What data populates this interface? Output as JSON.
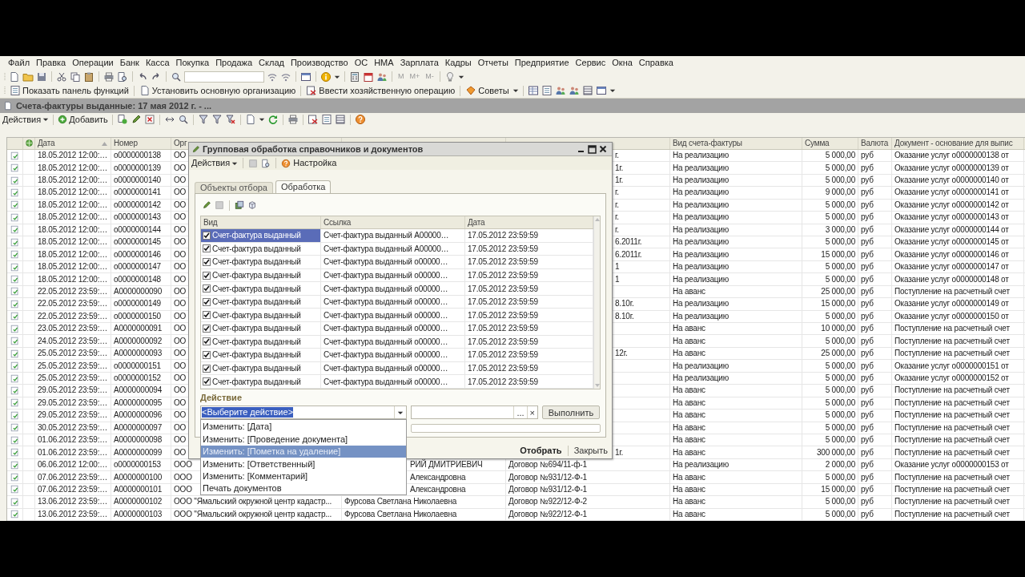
{
  "menu_bar": [
    "Файл",
    "Правка",
    "Операции",
    "Банк",
    "Касса",
    "Покупка",
    "Продажа",
    "Склад",
    "Производство",
    "ОС",
    "НМА",
    "Зарплата",
    "Кадры",
    "Отчеты",
    "Предприятие",
    "Сервис",
    "Окна",
    "Справка"
  ],
  "toolbar": {
    "memory_buttons": [
      "M",
      "M+",
      "M-"
    ]
  },
  "function_toolbar": [
    "Показать панель функций",
    "Установить основную организацию",
    "Ввести хозяйственную операцию",
    "Советы"
  ],
  "document_window": {
    "title": "Счета-фактуры выданные: 17 мая 2012 г. - ...",
    "actions_menu": "Действия",
    "add_button": "Добавить"
  },
  "table": {
    "columns": [
      {
        "label": "Дата",
        "sorted": true
      },
      {
        "label": "Номер",
        "sorted": false
      },
      {
        "label": "Орг"
      },
      {
        "label": "Вид счета-фактуры",
        "sorted": false
      },
      {
        "label": "Сумма",
        "sorted": false
      },
      {
        "label": "Валюта",
        "sorted": false
      },
      {
        "label": "Документ - основание для выпис",
        "sorted": false
      }
    ],
    "rows": [
      {
        "date": "18.05.2012 12:00:…",
        "number": "о0000000138",
        "org": "ОО",
        "column_6": "г.",
        "type": "На реализацию",
        "sum": "5 000,00",
        "currency": "руб",
        "basis": "Оказание услуг о0000000138 от"
      },
      {
        "date": "18.05.2012 12:00:…",
        "number": "о0000000139",
        "org": "ОО",
        "column_6": "1г.",
        "type": "На реализацию",
        "sum": "5 000,00",
        "currency": "руб",
        "basis": "Оказание услуг о0000000139 от"
      },
      {
        "date": "18.05.2012 12:00:…",
        "number": "о0000000140",
        "org": "ОО",
        "column_6": "1г.",
        "type": "На реализацию",
        "sum": "5 000,00",
        "currency": "руб",
        "basis": "Оказание услуг о0000000140 от"
      },
      {
        "date": "18.05.2012 12:00:…",
        "number": "о0000000141",
        "org": "ОО",
        "column_6": "г.",
        "type": "На реализацию",
        "sum": "9 000,00",
        "currency": "руб",
        "basis": "Оказание услуг о0000000141 от"
      },
      {
        "date": "18.05.2012 12:00:…",
        "number": "о0000000142",
        "org": "ОО",
        "column_6": "г.",
        "type": "На реализацию",
        "sum": "5 000,00",
        "currency": "руб",
        "basis": "Оказание услуг о0000000142 от"
      },
      {
        "date": "18.05.2012 12:00:…",
        "number": "о0000000143",
        "org": "ОО",
        "column_6": "г.",
        "type": "На реализацию",
        "sum": "5 000,00",
        "currency": "руб",
        "basis": "Оказание услуг о0000000143 от"
      },
      {
        "date": "18.05.2012 12:00:…",
        "number": "о0000000144",
        "org": "ОО",
        "column_6": "г.",
        "type": "На реализацию",
        "sum": "3 000,00",
        "currency": "руб",
        "basis": "Оказание услуг о0000000144 от"
      },
      {
        "date": "18.05.2012 12:00:…",
        "number": "о0000000145",
        "org": "ОО",
        "column_6": "6.2011г.",
        "type": "На реализацию",
        "sum": "5 000,00",
        "currency": "руб",
        "basis": "Оказание услуг о0000000145 от"
      },
      {
        "date": "18.05.2012 12:00:…",
        "number": "о0000000146",
        "org": "ОО",
        "column_6": "6.2011г.",
        "type": "На реализацию",
        "sum": "15 000,00",
        "currency": "руб",
        "basis": "Оказание услуг о0000000146 от"
      },
      {
        "date": "18.05.2012 12:00:…",
        "number": "о0000000147",
        "org": "ОО",
        "column_6": "1",
        "type": "На реализацию",
        "sum": "5 000,00",
        "currency": "руб",
        "basis": "Оказание услуг о0000000147 от"
      },
      {
        "date": "18.05.2012 12:00:…",
        "number": "о0000000148",
        "org": "ОО",
        "column_6": "1",
        "type": "На реализацию",
        "sum": "5 000,00",
        "currency": "руб",
        "basis": "Оказание услуг о0000000148 от"
      },
      {
        "date": "22.05.2012 23:59:…",
        "number": "А0000000090",
        "org": "ОО",
        "type": "На аванс",
        "sum": "25 000,00",
        "currency": "руб",
        "basis": "Поступление на расчетный счет"
      },
      {
        "date": "22.05.2012 23:59:…",
        "number": "о0000000149",
        "org": "ОО",
        "column_6": "8.10г.",
        "type": "На реализацию",
        "sum": "15 000,00",
        "currency": "руб",
        "basis": "Оказание услуг о0000000149 от"
      },
      {
        "date": "22.05.2012 23:59:…",
        "number": "о0000000150",
        "org": "ОО",
        "column_6": "8.10г.",
        "type": "На реализацию",
        "sum": "5 000,00",
        "currency": "руб",
        "basis": "Оказание услуг о0000000150 от"
      },
      {
        "date": "23.05.2012 23:59:…",
        "number": "А0000000091",
        "org": "ОО",
        "type": "На аванс",
        "sum": "10 000,00",
        "currency": "руб",
        "basis": "Поступление на расчетный счет"
      },
      {
        "date": "24.05.2012 23:59:…",
        "number": "А0000000092",
        "org": "ОО",
        "type": "На аванс",
        "sum": "5 000,00",
        "currency": "руб",
        "basis": "Поступление на расчетный счет"
      },
      {
        "date": "25.05.2012 23:59:…",
        "number": "А0000000093",
        "org": "ОО",
        "column_6": "12г.",
        "type": "На аванс",
        "sum": "25 000,00",
        "currency": "руб",
        "basis": "Поступление на расчетный счет"
      },
      {
        "date": "25.05.2012 23:59:…",
        "number": "о0000000151",
        "org": "ОО",
        "type": "На реализацию",
        "sum": "5 000,00",
        "currency": "руб",
        "basis": "Оказание услуг о0000000151 от"
      },
      {
        "date": "25.05.2012 23:59:…",
        "number": "о0000000152",
        "org": "ОО",
        "type": "На реализацию",
        "sum": "5 000,00",
        "currency": "руб",
        "basis": "Оказание услуг о0000000152 от"
      },
      {
        "date": "29.05.2012 23:59:…",
        "number": "А0000000094",
        "org": "ОО",
        "type": "На аванс",
        "sum": "5 000,00",
        "currency": "руб",
        "basis": "Поступление на расчетный счет"
      },
      {
        "date": "29.05.2012 23:59:…",
        "number": "А0000000095",
        "org": "ОО",
        "type": "На аванс",
        "sum": "5 000,00",
        "currency": "руб",
        "basis": "Поступление на расчетный счет"
      },
      {
        "date": "29.05.2012 23:59:…",
        "number": "А0000000096",
        "org": "ОО",
        "type": "На аванс",
        "sum": "5 000,00",
        "currency": "руб",
        "basis": "Поступление на расчетный счет"
      },
      {
        "date": "30.05.2012 23:59:…",
        "number": "А0000000097",
        "org": "ОО",
        "type": "На аванс",
        "sum": "5 000,00",
        "currency": "руб",
        "basis": "Поступление на расчетный счет"
      },
      {
        "date": "01.06.2012 23:59:…",
        "number": "А0000000098",
        "org": "ОО",
        "type": "На аванс",
        "sum": "5 000,00",
        "currency": "руб",
        "basis": "Поступление на расчетный счет"
      },
      {
        "date": "01.06.2012 23:59:…",
        "number": "А0000000099",
        "org": "ОО",
        "column_6": "1г.",
        "type": "На аванс",
        "sum": "300 000,00",
        "currency": "руб",
        "basis": "Поступление на расчетный счет"
      },
      {
        "date": "06.06.2012 12:00:…",
        "number": "о0000000153",
        "org": "ООО",
        "column_5": "РИЙ ДМИТРИЕВИЧ",
        "column_6": "Договор №694/11-ф-1",
        "type": "На реализацию",
        "sum": "2 000,00",
        "currency": "руб",
        "basis": "Оказание услуг о0000000153 от"
      },
      {
        "date": "07.06.2012 23:59:…",
        "number": "А0000000100",
        "org": "ООО",
        "column_5": "Александровна",
        "column_6": "Договор №931/12-Ф-1",
        "type": "На аванс",
        "sum": "5 000,00",
        "currency": "руб",
        "basis": "Поступление на расчетный счет"
      },
      {
        "date": "07.06.2012 23:59:…",
        "number": "А0000000101",
        "org": "ООО",
        "column_5": "Александровна",
        "column_6": "Договор №931/12-Ф-1",
        "type": "На аванс",
        "sum": "15 000,00",
        "currency": "руб",
        "basis": "Поступление на расчетный счет"
      },
      {
        "date": "13.06.2012 23:59:…",
        "number": "А0000000102",
        "org": "ООО \"Ямальский окружной центр кадастр...",
        "column_5": "Фурсова Светлана Николаевна",
        "column_6": "Договор №922/12-Ф-2",
        "type": "На аванс",
        "sum": "5 000,00",
        "currency": "руб",
        "basis": "Поступление на расчетный счет"
      },
      {
        "date": "13.06.2012 23:59:…",
        "number": "А0000000103",
        "org": "ООО \"Ямальский окружной центр кадастр...",
        "column_5": "Фурсова Светлана Николаевна",
        "column_6": "Договор №922/12-Ф-1",
        "type": "На аванс",
        "sum": "5 000,00",
        "currency": "руб",
        "basis": "Поступление на расчетный счет"
      }
    ]
  },
  "dialog": {
    "title": "Групповая обработка справочников и документов",
    "actions_menu": "Действия",
    "settings_button": "Настройка",
    "tabs": [
      {
        "label": "Объекты отбора",
        "selected": false
      },
      {
        "label": "Обработка",
        "selected": true
      }
    ],
    "table": {
      "columns": [
        "Вид",
        "Ссылка",
        "Дата"
      ],
      "rows": [
        {
          "checked": true,
          "selected": true,
          "kind_name": "Счет-фактура выданный",
          "link": "Счет-фактура выданный А00000…",
          "date": "17.05.2012 23:59:59"
        },
        {
          "checked": true,
          "selected": false,
          "kind_name": "Счет-фактура выданный",
          "link": "Счет-фактура выданный А00000…",
          "date": "17.05.2012 23:59:59"
        },
        {
          "checked": true,
          "selected": false,
          "kind_name": "Счет-фактура выданный",
          "link": "Счет-фактура выданный о00000…",
          "date": "17.05.2012 23:59:59"
        },
        {
          "checked": true,
          "selected": false,
          "kind_name": "Счет-фактура выданный",
          "link": "Счет-фактура выданный о00000…",
          "date": "17.05.2012 23:59:59"
        },
        {
          "checked": true,
          "selected": false,
          "kind_name": "Счет-фактура выданный",
          "link": "Счет-фактура выданный о00000…",
          "date": "17.05.2012 23:59:59"
        },
        {
          "checked": true,
          "selected": false,
          "kind_name": "Счет-фактура выданный",
          "link": "Счет-фактура выданный о00000…",
          "date": "17.05.2012 23:59:59"
        },
        {
          "checked": true,
          "selected": false,
          "kind_name": "Счет-фактура выданный",
          "link": "Счет-фактура выданный о00000…",
          "date": "17.05.2012 23:59:59"
        },
        {
          "checked": true,
          "selected": false,
          "kind_name": "Счет-фактура выданный",
          "link": "Счет-фактура выданный о00000…",
          "date": "17.05.2012 23:59:59"
        },
        {
          "checked": true,
          "selected": false,
          "kind_name": "Счет-фактура выданный",
          "link": "Счет-фактура выданный о00000…",
          "date": "17.05.2012 23:59:59"
        },
        {
          "checked": true,
          "selected": false,
          "kind_name": "Счет-фактура выданный",
          "link": "Счет-фактура выданный о00000…",
          "date": "17.05.2012 23:59:59"
        },
        {
          "checked": true,
          "selected": false,
          "kind_name": "Счет-фактура выданный",
          "link": "Счет-фактура выданный о00000…",
          "date": "17.05.2012 23:59:59"
        },
        {
          "checked": true,
          "selected": false,
          "kind_name": "Счет-фактура выданный",
          "link": "Счет-фактура выданный о00000…",
          "date": "17.05.2012 23:59:59"
        }
      ]
    },
    "action_label": "Действие",
    "action_select": {
      "value": "<Выберите действие>",
      "highlighted": true
    },
    "picker_buttons": [
      "...",
      "×"
    ],
    "execute_button": "Выполнить",
    "footer_buttons": [
      {
        "label": "Отобрать",
        "bold": true
      },
      {
        "label": "Закрыть",
        "bold": false
      }
    ],
    "dropdown": [
      {
        "label": "Изменить: [Дата]",
        "selected": false
      },
      {
        "label": "Изменить: [Проведение документа]",
        "selected": false
      },
      {
        "label": "Изменить: [Пометка на удаление]",
        "selected": true
      },
      {
        "label": "Изменить: [Ответственный]",
        "selected": false
      },
      {
        "label": "Изменить: [Комментарий]",
        "selected": false
      },
      {
        "label": "Печать документов",
        "selected": false
      }
    ]
  }
}
